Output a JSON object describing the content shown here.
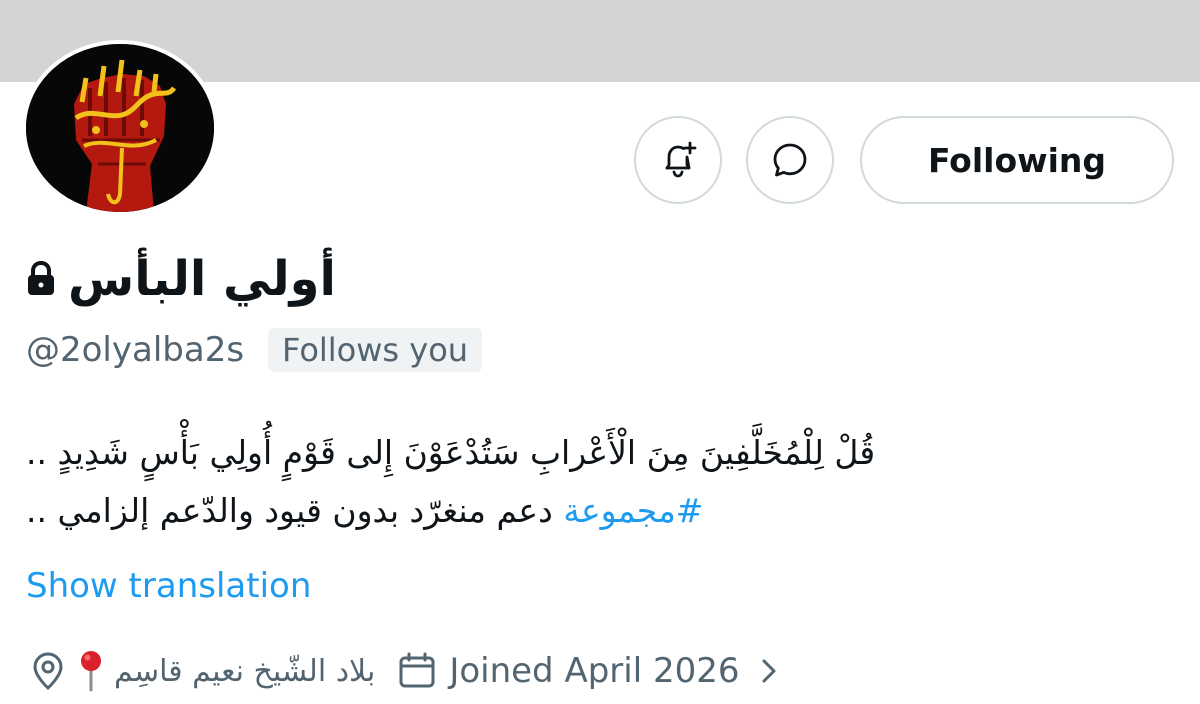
{
  "profile": {
    "display_name": "أولي البأس",
    "handle": "@2olyalba2s",
    "follows_you_label": "Follows you",
    "bio_line1": "قُلْ لِلْمُخَلَّفِينَ مِنَ الْأَعْرابِ سَتُدْعَوْنَ إِلى قَوْمٍ أُولِي بَأْسٍ شَدِيدٍ ..",
    "bio_line2_prefix": "#مجموعة",
    "bio_line2_rest": " دعم منغرّد بدون قيود والدّعم إلزامي ..",
    "show_translation_label": "Show translation",
    "location": "بلاد الشّيخ نعيم قاسِم",
    "joined": "Joined April 2026"
  },
  "actions": {
    "following_label": "Following",
    "notify_icon": "bell-plus-icon",
    "message_icon": "message-bubble-icon"
  },
  "icons": {
    "lock": "lock-icon",
    "location": "location-pin-icon",
    "location_emoji": "red-pin-emoji",
    "calendar": "calendar-icon",
    "chevron": "chevron-right-icon"
  },
  "colors": {
    "accent": "#1d9bf0",
    "secondary_text": "#536471",
    "primary_text": "#0f1419",
    "border": "#cfd9de",
    "badge_bg": "#eff3f4",
    "banner": "#d4d4d4"
  }
}
